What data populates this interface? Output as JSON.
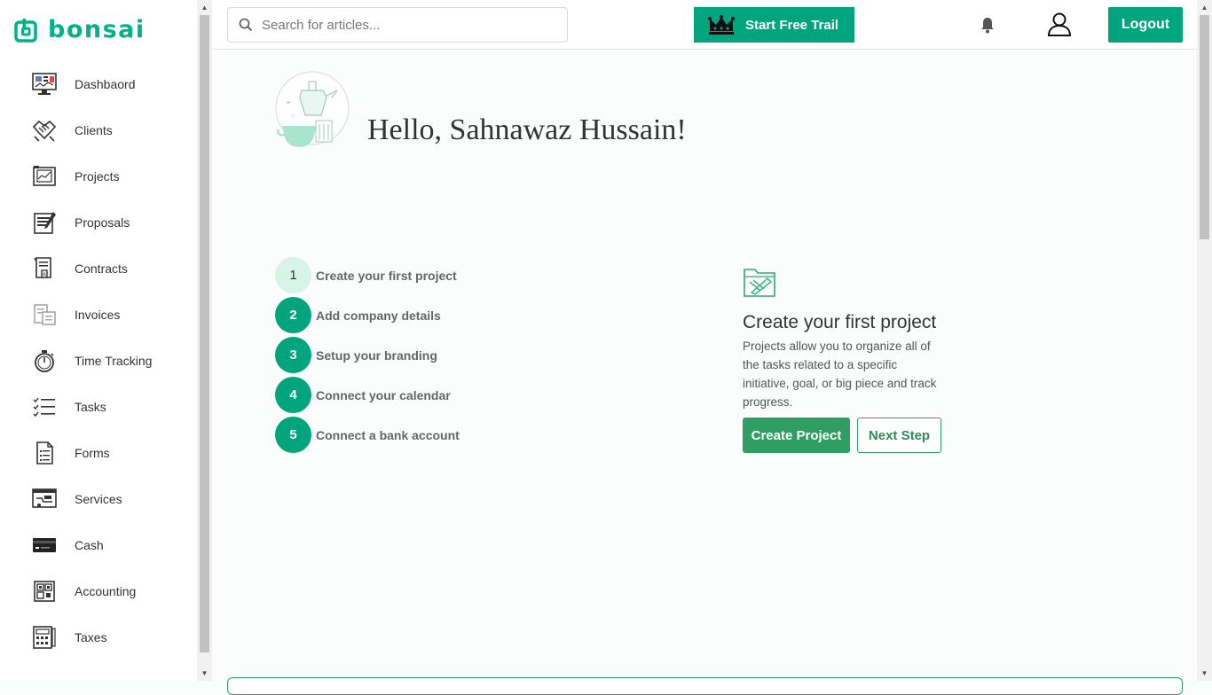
{
  "brand": {
    "name": "bonsai",
    "color": "#00b289"
  },
  "sidebar": {
    "items": [
      {
        "label": "Dashbaord",
        "icon": "dashboard-icon"
      },
      {
        "label": "Clients",
        "icon": "handshake-icon"
      },
      {
        "label": "Projects",
        "icon": "projects-icon"
      },
      {
        "label": "Proposals",
        "icon": "proposal-icon"
      },
      {
        "label": "Contracts",
        "icon": "contract-icon"
      },
      {
        "label": "Invoices",
        "icon": "invoice-icon"
      },
      {
        "label": "Time Tracking",
        "icon": "stopwatch-icon"
      },
      {
        "label": "Tasks",
        "icon": "checklist-icon"
      },
      {
        "label": "Forms",
        "icon": "form-icon"
      },
      {
        "label": "Services",
        "icon": "services-icon"
      },
      {
        "label": "Cash",
        "icon": "credit-card-icon"
      },
      {
        "label": "Accounting",
        "icon": "accounting-icon"
      },
      {
        "label": "Taxes",
        "icon": "calculator-icon"
      }
    ]
  },
  "header": {
    "search_placeholder": "Search for articles...",
    "trial_label": "Start Free Trail",
    "logout_label": "Logout"
  },
  "greeting": "Hello, Sahnawaz Hussain!",
  "steps": [
    {
      "num": "1",
      "label": "Create your first project",
      "active": true
    },
    {
      "num": "2",
      "label": "Add company details"
    },
    {
      "num": "3",
      "label": "Setup your branding"
    },
    {
      "num": "4",
      "label": "Connect your calendar"
    },
    {
      "num": "5",
      "label": "Connect a bank account"
    }
  ],
  "detail": {
    "title": "Create your first project",
    "description": "Projects allow you to organize all of the tasks related to a specific initiative, goal, or big piece and track progress.",
    "primary_label": "Create Project",
    "secondary_label": "Next Step"
  },
  "colors": {
    "accent": "#00a57e",
    "button_green": "#2e9e63",
    "step_active_bg": "#d6f4e8"
  }
}
